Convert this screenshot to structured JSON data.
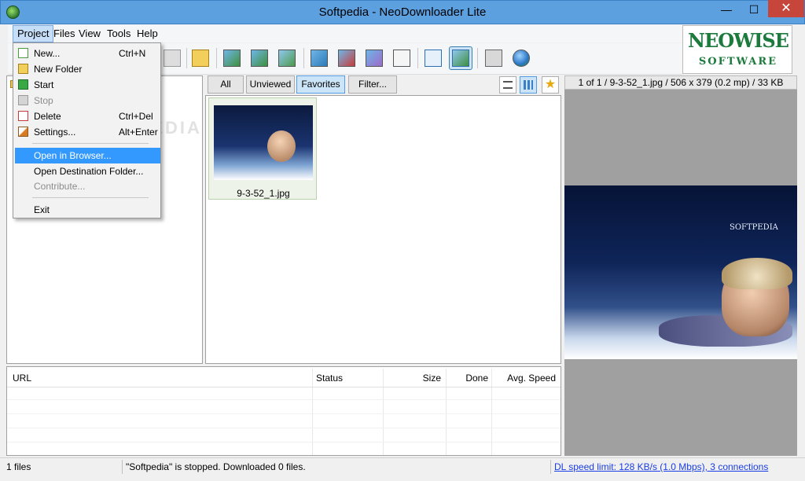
{
  "window": {
    "title": "Softpedia - NeoDownloader Lite",
    "min": "—",
    "max": "☐",
    "close": "✕"
  },
  "menubar": {
    "items": [
      "Project",
      "Files",
      "View",
      "Tools",
      "Help"
    ]
  },
  "logo": {
    "line1": "NEOWISE",
    "line2": "SOFTWARE",
    "color": "#1b7a3c"
  },
  "project_menu": {
    "items": [
      {
        "label": "New...",
        "shortcut": "Ctrl+N"
      },
      {
        "label": "New Folder",
        "shortcut": ""
      },
      {
        "label": "Start",
        "shortcut": ""
      },
      {
        "label": "Stop",
        "shortcut": ""
      },
      {
        "label": "Delete",
        "shortcut": "Ctrl+Del"
      },
      {
        "label": "Settings...",
        "shortcut": "Alt+Enter"
      },
      {
        "label": "Open in Browser...",
        "shortcut": ""
      },
      {
        "label": "Open Destination Folder...",
        "shortcut": ""
      },
      {
        "label": "Contribute...",
        "shortcut": ""
      },
      {
        "label": "Exit",
        "shortcut": ""
      }
    ]
  },
  "filters": {
    "all": "All",
    "unviewed": "Unviewed",
    "favorites": "Favorites",
    "filter": "Filter..."
  },
  "gallery": {
    "items": [
      {
        "caption": "9-3-52_1.jpg"
      }
    ]
  },
  "preview": {
    "header": "1 of 1 / 9-3-52_1.jpg / 506 x 379 (0.2 mp) / 33 KB",
    "brand": "SOFTPEDIA"
  },
  "downloads": {
    "columns": {
      "url": "URL",
      "status": "Status",
      "size": "Size",
      "done": "Done",
      "speed": "Avg. Speed"
    }
  },
  "statusbar": {
    "files": "1 files",
    "message": "\"Softpedia\" is stopped. Downloaded 0 files.",
    "speed": "DL speed limit: 128 KB/s (1.0 Mbps), 3 connections"
  },
  "watermark": "SOFTPEDIA",
  "colors": {
    "titlebar": "#5ca0e0",
    "highlight": "#3399ff",
    "close": "#c7463b",
    "link": "#1a3ee6"
  }
}
